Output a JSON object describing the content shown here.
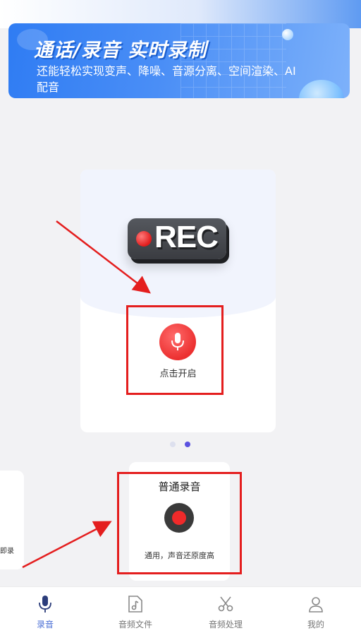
{
  "banner": {
    "title": "通话/录音 实时录制",
    "subtitle": "还能轻松实现变声、降噪、音源分离、空间渲染、AI配音"
  },
  "record_card": {
    "badge_text": "REC",
    "start_label": "点击开启"
  },
  "carousel": {
    "page_count": 2,
    "active_index": 1
  },
  "mode_card": {
    "title": "普通录音",
    "description": "通用，声音还原度高"
  },
  "side_card": {
    "text": "即录"
  },
  "tabs": [
    {
      "label": "录音",
      "icon": "mic-icon",
      "active": true
    },
    {
      "label": "音频文件",
      "icon": "music-file-icon",
      "active": false
    },
    {
      "label": "音频处理",
      "icon": "scissors-icon",
      "active": false
    },
    {
      "label": "我的",
      "icon": "user-icon",
      "active": false
    }
  ],
  "colors": {
    "accent": "#4b6fd6",
    "record_red": "#ec3030",
    "highlight_red": "#e41e1e",
    "banner_blue": "#2f7cf3"
  }
}
